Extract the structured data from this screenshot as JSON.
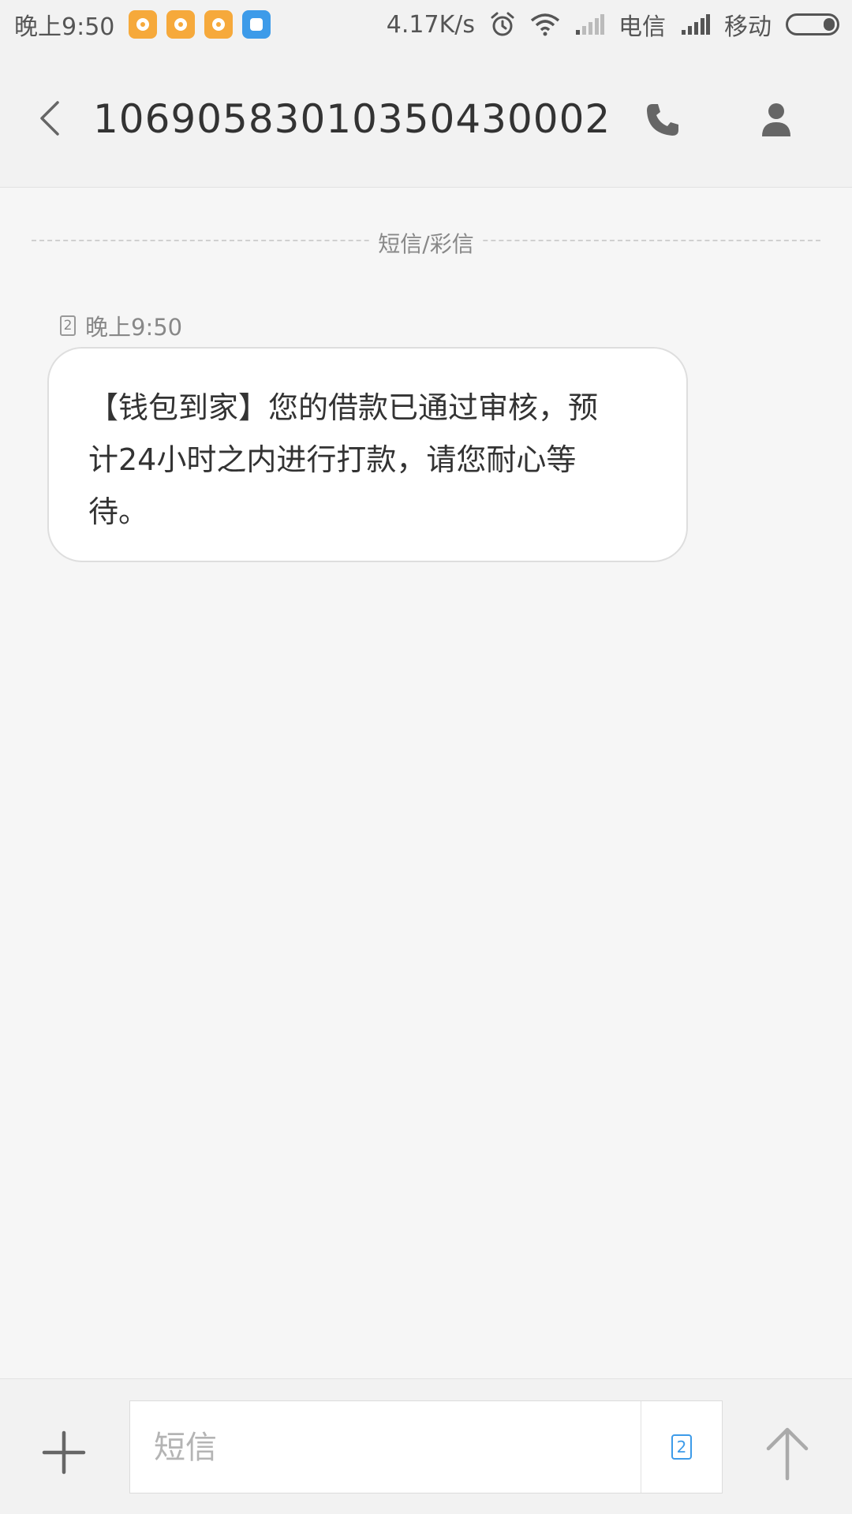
{
  "status_bar": {
    "time": "晚上9:50",
    "network_speed": "4.17K/s",
    "carrier_1": "电信",
    "carrier_2": "移动",
    "icons": [
      "orange-chat-notification-icon",
      "orange-chat-notification-icon",
      "orange-chat-notification-icon",
      "blue-app-notification-icon",
      "alarm-icon",
      "wifi-icon",
      "signal-icon",
      "signal-icon",
      "battery-icon"
    ]
  },
  "header": {
    "contact_number": "1069058301035043000​2",
    "icons": [
      "back-arrow-icon",
      "phone-icon",
      "person-icon"
    ]
  },
  "conversation": {
    "type_label": "短信/彩信",
    "message": {
      "sim": "2",
      "time": "晚上9:50",
      "text_lines": [
        "【钱包到家】您的借款已通过审核，预",
        "计24小时之内进行打款，请您耐心等",
        "待。"
      ]
    }
  },
  "compose": {
    "placeholder": "短信",
    "sim": "2",
    "icons": [
      "plus-icon",
      "sim-card-icon",
      "send-arrow-icon"
    ]
  },
  "colors": {
    "accent_blue": "#3d9be9",
    "notification_orange": "#f6a93b",
    "background": "#f6f6f6",
    "bubble": "#ffffff"
  }
}
